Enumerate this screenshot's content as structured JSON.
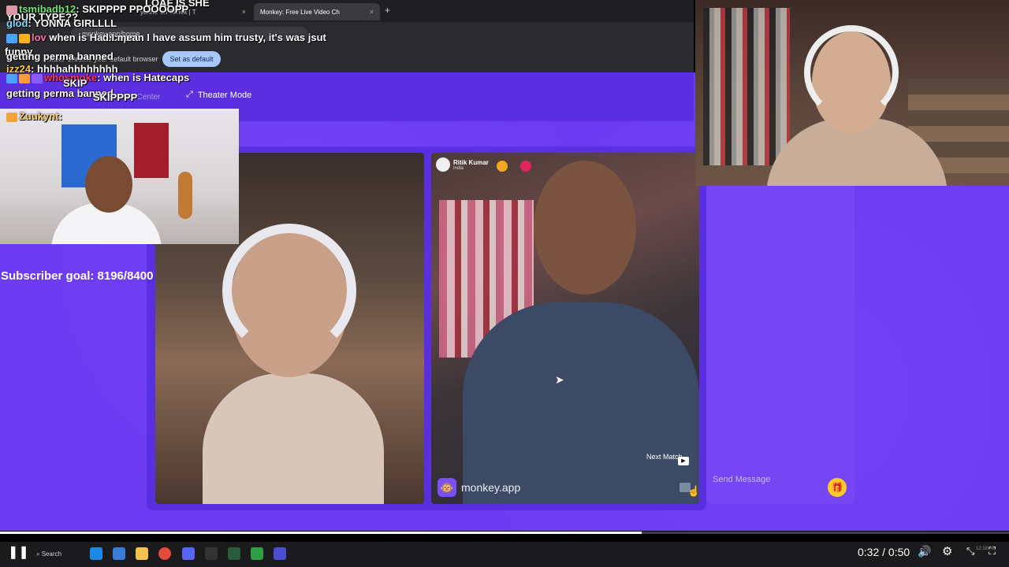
{
  "browser": {
    "tabs": [
      {
        "label": "yonna' on TikTok | T",
        "close": "×"
      },
      {
        "label": "Monkey: Free Live Video Ch",
        "close": "×"
      }
    ],
    "new_tab": "+",
    "address": "monkey.app/home",
    "default_prompt": "Make Chrome your default browser",
    "set_default_label": "Set as default"
  },
  "site": {
    "community_center": "Community Center",
    "theater_mode": "Theater Mode",
    "match": {
      "name": "Ritik Kumar",
      "country": "India",
      "next_match": "Next Match"
    },
    "logo_text": "monkey.app",
    "message_placeholder": "Send Message"
  },
  "stream": {
    "subscriber_goal": "Subscriber goal: 8196/8400",
    "chat": [
      {
        "text": "LOAF IS SHE"
      },
      {
        "text": "YOUR TYPE??"
      },
      {
        "user": "tsmibadb12",
        "text": "SKIPPPP PPOOOOPP"
      },
      {
        "user": "glod",
        "text": "YONNA GIRLLLL"
      },
      {
        "user": "lov",
        "text": "when is Hatecaps"
      },
      {
        "text": "getting perma banned"
      },
      {
        "user": "izz24",
        "text": "hhhhahhhhhhhh"
      },
      {
        "user": "whosmoke",
        "text": "when is Hatecaps"
      },
      {
        "text": "getting perma banned"
      },
      {
        "user": "Zuukynt",
        "text": ""
      },
      {
        "text": "d I mean I have  assum him trusty, it's was jsut"
      },
      {
        "text": "funny"
      },
      {
        "text": "SKIP"
      },
      {
        "text": "SKIPPPP"
      }
    ]
  },
  "player": {
    "time": "0:32 / 0:50",
    "progress": 0.636,
    "search_label": "Search",
    "clock_ghost": "12:18 AM"
  },
  "colors": {
    "site_bg": "#6c3bf2",
    "chat_panel": "#7646f5",
    "gift": "#ffc928"
  }
}
